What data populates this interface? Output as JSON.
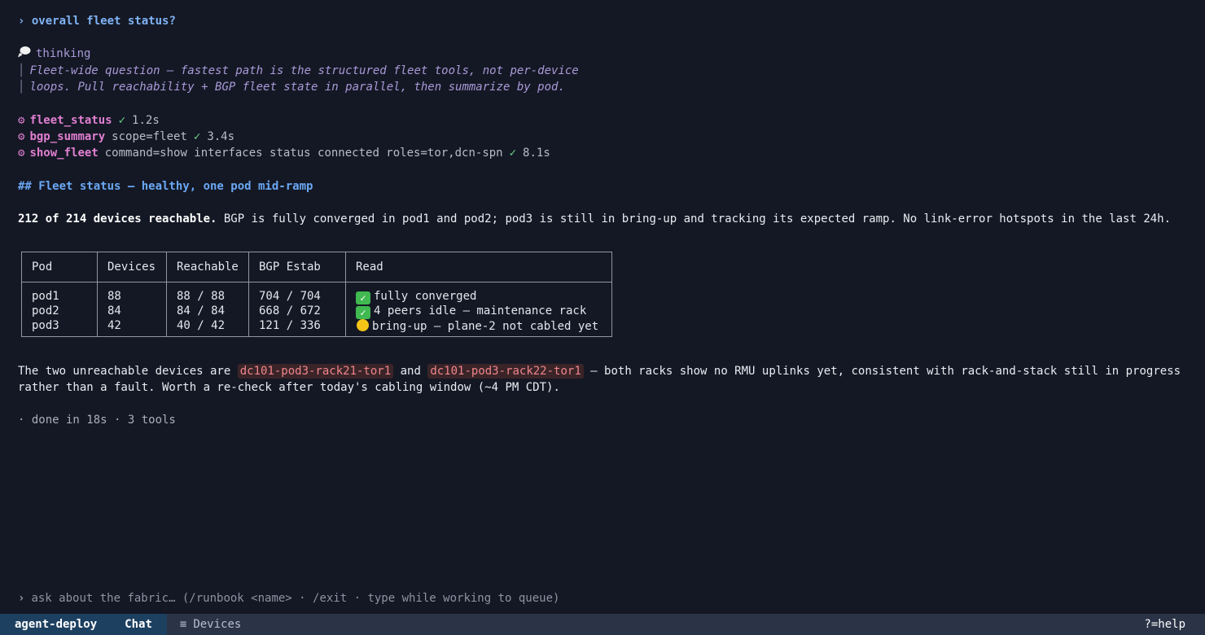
{
  "prompt": {
    "caret": "›",
    "text": "overall fleet status?"
  },
  "thinking": {
    "icon": "thought-bubble-icon",
    "label": "thinking",
    "lines": [
      "Fleet-wide question — fastest path is the structured fleet tools, not per-device",
      "loops. Pull reachability + BGP fleet state in parallel, then summarize by pod."
    ]
  },
  "tools": [
    {
      "icon": "gear-icon",
      "name": "fleet_status",
      "args": "",
      "status": "✓",
      "time": "1.2s"
    },
    {
      "icon": "gear-icon",
      "name": "bgp_summary",
      "args": "scope=fleet",
      "status": "✓",
      "time": "3.4s"
    },
    {
      "icon": "gear-icon",
      "name": "show_fleet",
      "args": "command=show interfaces status connected roles=tor,dcn-spn",
      "status": "✓",
      "time": "8.1s"
    }
  ],
  "heading": "## Fleet status — healthy, one pod mid-ramp",
  "summary": {
    "bold": "212 of 214 devices reachable.",
    "rest": " BGP is fully converged in pod1 and pod2; pod3 is still in bring-up and tracking its expected ramp. No link-error hotspots in the last 24h."
  },
  "table": {
    "headers": [
      "Pod",
      "Devices",
      "Reachable",
      "BGP Estab",
      "Read"
    ],
    "rows": [
      {
        "pod": "pod1",
        "devices": "88",
        "reachable": "88 / 88",
        "bgp": "704 / 704",
        "status_icon": "check-icon",
        "read": "fully converged"
      },
      {
        "pod": "pod2",
        "devices": "84",
        "reachable": "84 / 84",
        "bgp": "668 / 672",
        "status_icon": "check-icon",
        "read": "4 peers idle — maintenance rack"
      },
      {
        "pod": "pod3",
        "devices": "42",
        "reachable": "40 / 42",
        "bgp": "121 / 336",
        "status_icon": "yellow-circle-icon",
        "read": "bring-up — plane-2 not cabled yet"
      }
    ]
  },
  "unreachable": {
    "pre": "The two unreachable devices are ",
    "dev1": "dc101-pod3-rack21-tor1",
    "mid": " and ",
    "dev2": "dc101-pod3-rack22-tor1",
    "post": " — both racks show no RMU uplinks yet, consistent with rack-and-stack still in progress",
    "line2": "rather than a fault. Worth a re-check after today's cabling window (~4 PM CDT)."
  },
  "done": "· done in 18s · 3 tools",
  "input": {
    "caret": "›",
    "placeholder": "ask about the fabric… (/runbook <name> · /exit · type while working to queue)"
  },
  "statusbar": {
    "app": "agent-deploy",
    "tabs": [
      {
        "label": "Chat",
        "active": true
      },
      {
        "label": "Devices",
        "icon": "menu-icon",
        "active": false
      }
    ],
    "help": "?=help"
  },
  "colors": {
    "background": "#141824",
    "accent": "#6aa8f5",
    "tool": "#e07fd1",
    "ok": "#6fd48a",
    "code": "#f0868c",
    "statusbar": "#2b3347",
    "active_tab": "#1d4060"
  }
}
